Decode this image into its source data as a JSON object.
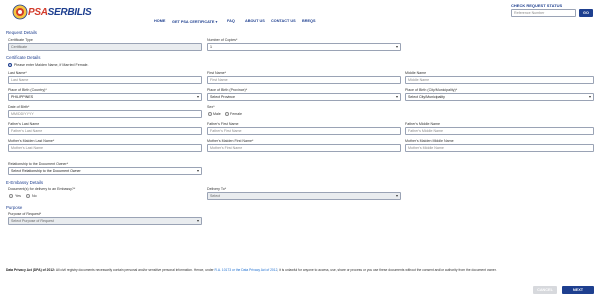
{
  "header": {
    "logo_text_a": "PSA",
    "logo_text_b": "SERBILIS",
    "nav": [
      "HOME",
      "GET PSA CERTIFICATE",
      "FAQ",
      "ABOUT US",
      "CONTACT US",
      "BREQS"
    ],
    "check_title": "CHECK REQUEST STATUS",
    "check_placeholder": "Reference Number",
    "go_label": "GO"
  },
  "request_details": {
    "section": "Request Details",
    "cert_type_label": "Certificate Type",
    "cert_type_value": "Certificate",
    "copies_label": "Number of Copies*",
    "copies_value": "1"
  },
  "certificate_details": {
    "section": "Certificate Details",
    "note": "Please enter Maiden Name, if Married Female.",
    "last_name_label": "Last Name*",
    "last_name_placeholder": "Last Name",
    "first_name_label": "First Name*",
    "first_name_placeholder": "First Name",
    "middle_name_label": "Middle Name",
    "middle_name_placeholder": "Middle Name",
    "pob_country_label": "Place of Birth (Country)*",
    "pob_country_value": "PHILIPPINES",
    "pob_province_label": "Place of Birth (Province)*",
    "pob_province_value": "Select Province",
    "pob_city_label": "Place of Birth (City/Municipality)*",
    "pob_city_value": "Select City/Municipality",
    "dob_label": "Date of Birth*",
    "dob_placeholder": "MM/DD/YYYY",
    "sex_label": "Sex*",
    "sex_male": "Male",
    "sex_female": "Female",
    "father_last_label": "Father's Last Name",
    "father_last_placeholder": "Father's Last Name",
    "father_first_label": "Father's First Name",
    "father_first_placeholder": "Father's First Name",
    "father_middle_label": "Father's Middle Name",
    "father_middle_placeholder": "Father's Middle Name",
    "mother_last_label": "Mother's Maiden Last Name*",
    "mother_last_placeholder": "Mother's Last Name",
    "mother_first_label": "Mother's Maiden First Name*",
    "mother_first_placeholder": "Mother's First Name",
    "mother_middle_label": "Mother's Maiden Middle Name",
    "mother_middle_placeholder": "Mother's Middle Name",
    "relationship_label": "Relationship to the Document Owner*",
    "relationship_value": "Select Relationship to the Document Owner"
  },
  "embassy": {
    "section": "E-Embassy Details",
    "question_label": "Document(s) for delivery to an Embassy?*",
    "yes": "Yes",
    "no": "No",
    "deliver_label": "Delivery To*",
    "deliver_value": "Select"
  },
  "purpose": {
    "section": "Purpose",
    "label": "Purpose of Request*",
    "value": "Select Purpose of Request"
  },
  "footer": {
    "privacy_bold": "Data Privacy Act (DPA) of 2012:",
    "privacy_text": "All civil registry documents necessarily contain personal and/or sensitive personal information. Hence, under",
    "privacy_link": "R.A. 10173 or the Data Privacy Act of 2012",
    "privacy_text2": ", it is unlawful for anyone to access, use, share or process or you use these documents without the consent and/or authority from the document owner.",
    "cancel_label": "CANCEL",
    "next_label": "NEXT"
  },
  "colors": {
    "brand": "#1e3f8f",
    "accent": "#d23a2a"
  }
}
